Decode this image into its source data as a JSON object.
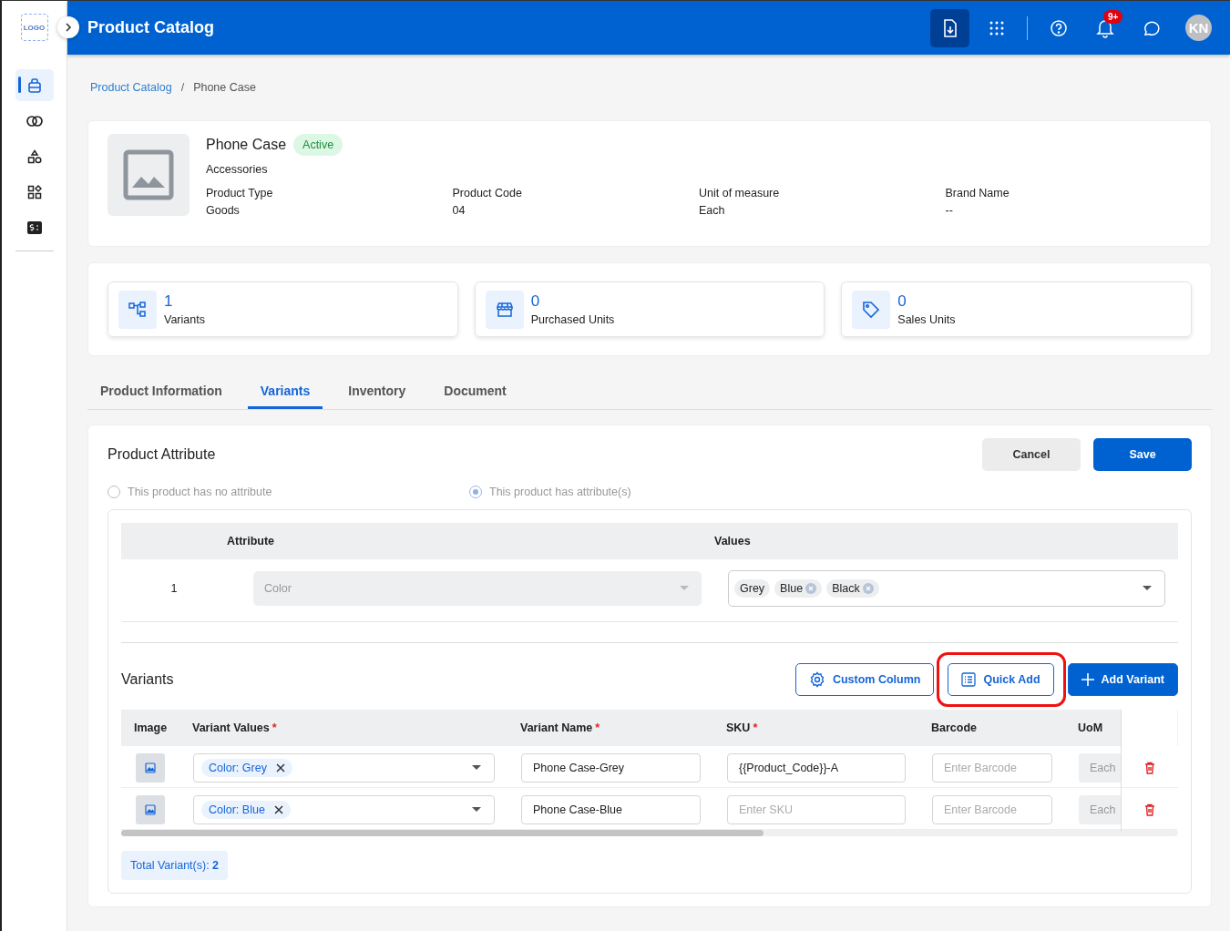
{
  "sidebar": {
    "logo": "LOGO",
    "items": [
      {
        "selected": true
      },
      {
        "selected": false
      },
      {
        "selected": false
      },
      {
        "selected": false
      },
      {
        "selected": false
      }
    ]
  },
  "header": {
    "title": "Product Catalog",
    "notification_badge": "9+",
    "avatar": "KN"
  },
  "breadcrumb": [
    {
      "label": "Product Catalog",
      "kind": "link"
    },
    {
      "label": "/",
      "kind": "separator"
    },
    {
      "label": "Phone Case",
      "kind": "current"
    }
  ],
  "product": {
    "name": "Phone Case",
    "status": "Active",
    "category": "Accessories",
    "fields": [
      {
        "label": "Product Type",
        "value": "Goods"
      },
      {
        "label": "Product Code",
        "value": "04"
      },
      {
        "label": "Unit of measure",
        "value": "Each"
      },
      {
        "label": "Brand Name",
        "value": "--"
      }
    ]
  },
  "stats": [
    {
      "value": "1",
      "label": "Variants",
      "kind": "variants"
    },
    {
      "value": "0",
      "label": "Purchased Units",
      "kind": "store"
    },
    {
      "value": "0",
      "label": "Sales Units",
      "kind": "tag"
    }
  ],
  "tabs": [
    {
      "label": "Product Information",
      "selected": false
    },
    {
      "label": "Variants",
      "selected": true
    },
    {
      "label": "Inventory",
      "selected": false
    },
    {
      "label": "Document",
      "selected": false
    }
  ],
  "attribute_section": {
    "title": "Product Attribute",
    "buttons": [
      {
        "label": "Cancel",
        "kind": "secondary"
      },
      {
        "label": "Save",
        "kind": "primary"
      }
    ],
    "options": [
      {
        "label": "This product has no attribute",
        "selected": false
      },
      {
        "label": "This product has attribute(s)",
        "selected": true
      }
    ],
    "columns": [
      "Attribute",
      "Values"
    ],
    "rows": [
      {
        "index": "1",
        "attribute_placeholder": "Color",
        "values": [
          {
            "label": "Grey",
            "removable": false
          },
          {
            "label": "Blue",
            "removable": true
          },
          {
            "label": "Black",
            "removable": true
          }
        ]
      }
    ]
  },
  "variants_section": {
    "title": "Variants",
    "buttons": [
      {
        "label": "Custom Column",
        "kind": "gear",
        "highlighted": false
      },
      {
        "label": "Quick Add",
        "kind": "list",
        "highlighted": true
      },
      {
        "label": "Add Variant",
        "kind": "plus",
        "highlighted": false
      }
    ],
    "columns": [
      {
        "label": "Image"
      },
      {
        "label": "Variant Values",
        "required_mark": "*"
      },
      {
        "label": "Variant Name",
        "required_mark": "*"
      },
      {
        "label": "SKU",
        "required_mark": "*"
      },
      {
        "label": "Barcode"
      },
      {
        "label": "UoM"
      }
    ],
    "rows": [
      {
        "value_chip": "Color: Grey",
        "name": "Phone Case-Grey",
        "sku": "{{Product_Code}}-A",
        "barcode_placeholder": "Enter Barcode",
        "uom": "Each"
      },
      {
        "value_chip": "Color: Blue",
        "name": "Phone Case-Blue",
        "sku": "",
        "sku_placeholder": "Enter SKU",
        "barcode_placeholder": "Enter Barcode",
        "uom": "Each"
      }
    ],
    "total": "Total Variant(s): **2**"
  }
}
